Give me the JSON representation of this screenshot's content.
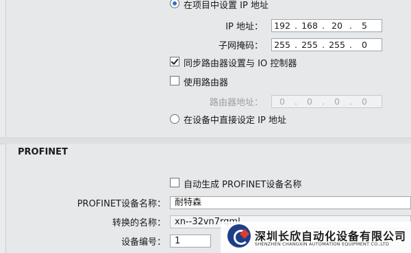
{
  "ip_section": {
    "set_in_project_label": "在项目中设置 IP 地址",
    "ip_address_label": "IP 地址：",
    "ip_address": [
      "192",
      "168",
      "20",
      "5"
    ],
    "subnet_mask_label": "子网掩码：",
    "subnet_mask": [
      "255",
      "255",
      "255",
      "0"
    ],
    "sync_router_label": "同步路由器设置与 IO 控制器",
    "sync_router_checked": true,
    "use_router_label": "使用路由器",
    "use_router_checked": false,
    "router_address_label": "路由器地址：",
    "router_address": [
      "0",
      "0",
      "0",
      "0"
    ],
    "set_on_device_label": "在设备中直接设定 IP 地址",
    "selected_option": "set_in_project"
  },
  "profinet_section": {
    "title": "PROFINET",
    "auto_generate_label": "自动生成 PROFINET设备名称",
    "auto_generate_checked": false,
    "device_name_label": "PROFINET设备名称：",
    "device_name_value": "耐特森",
    "converted_name_label": "转换的名称：",
    "converted_name_value": "xn--32vn7rqml",
    "device_number_label": "设备编号：",
    "device_number_value": "1"
  },
  "watermark": {
    "company_cn": "深圳长欣自动化设备有限公司",
    "company_en": "SHENZHEN CHANGXIN AUTOMATION EQUIPMENT CO.,LTD"
  },
  "colors": {
    "accent": "#2e6fd0",
    "panel_bg": "#e6e8ea",
    "logo_blue": "#1d3f8a",
    "logo_red": "#e23b2e"
  }
}
